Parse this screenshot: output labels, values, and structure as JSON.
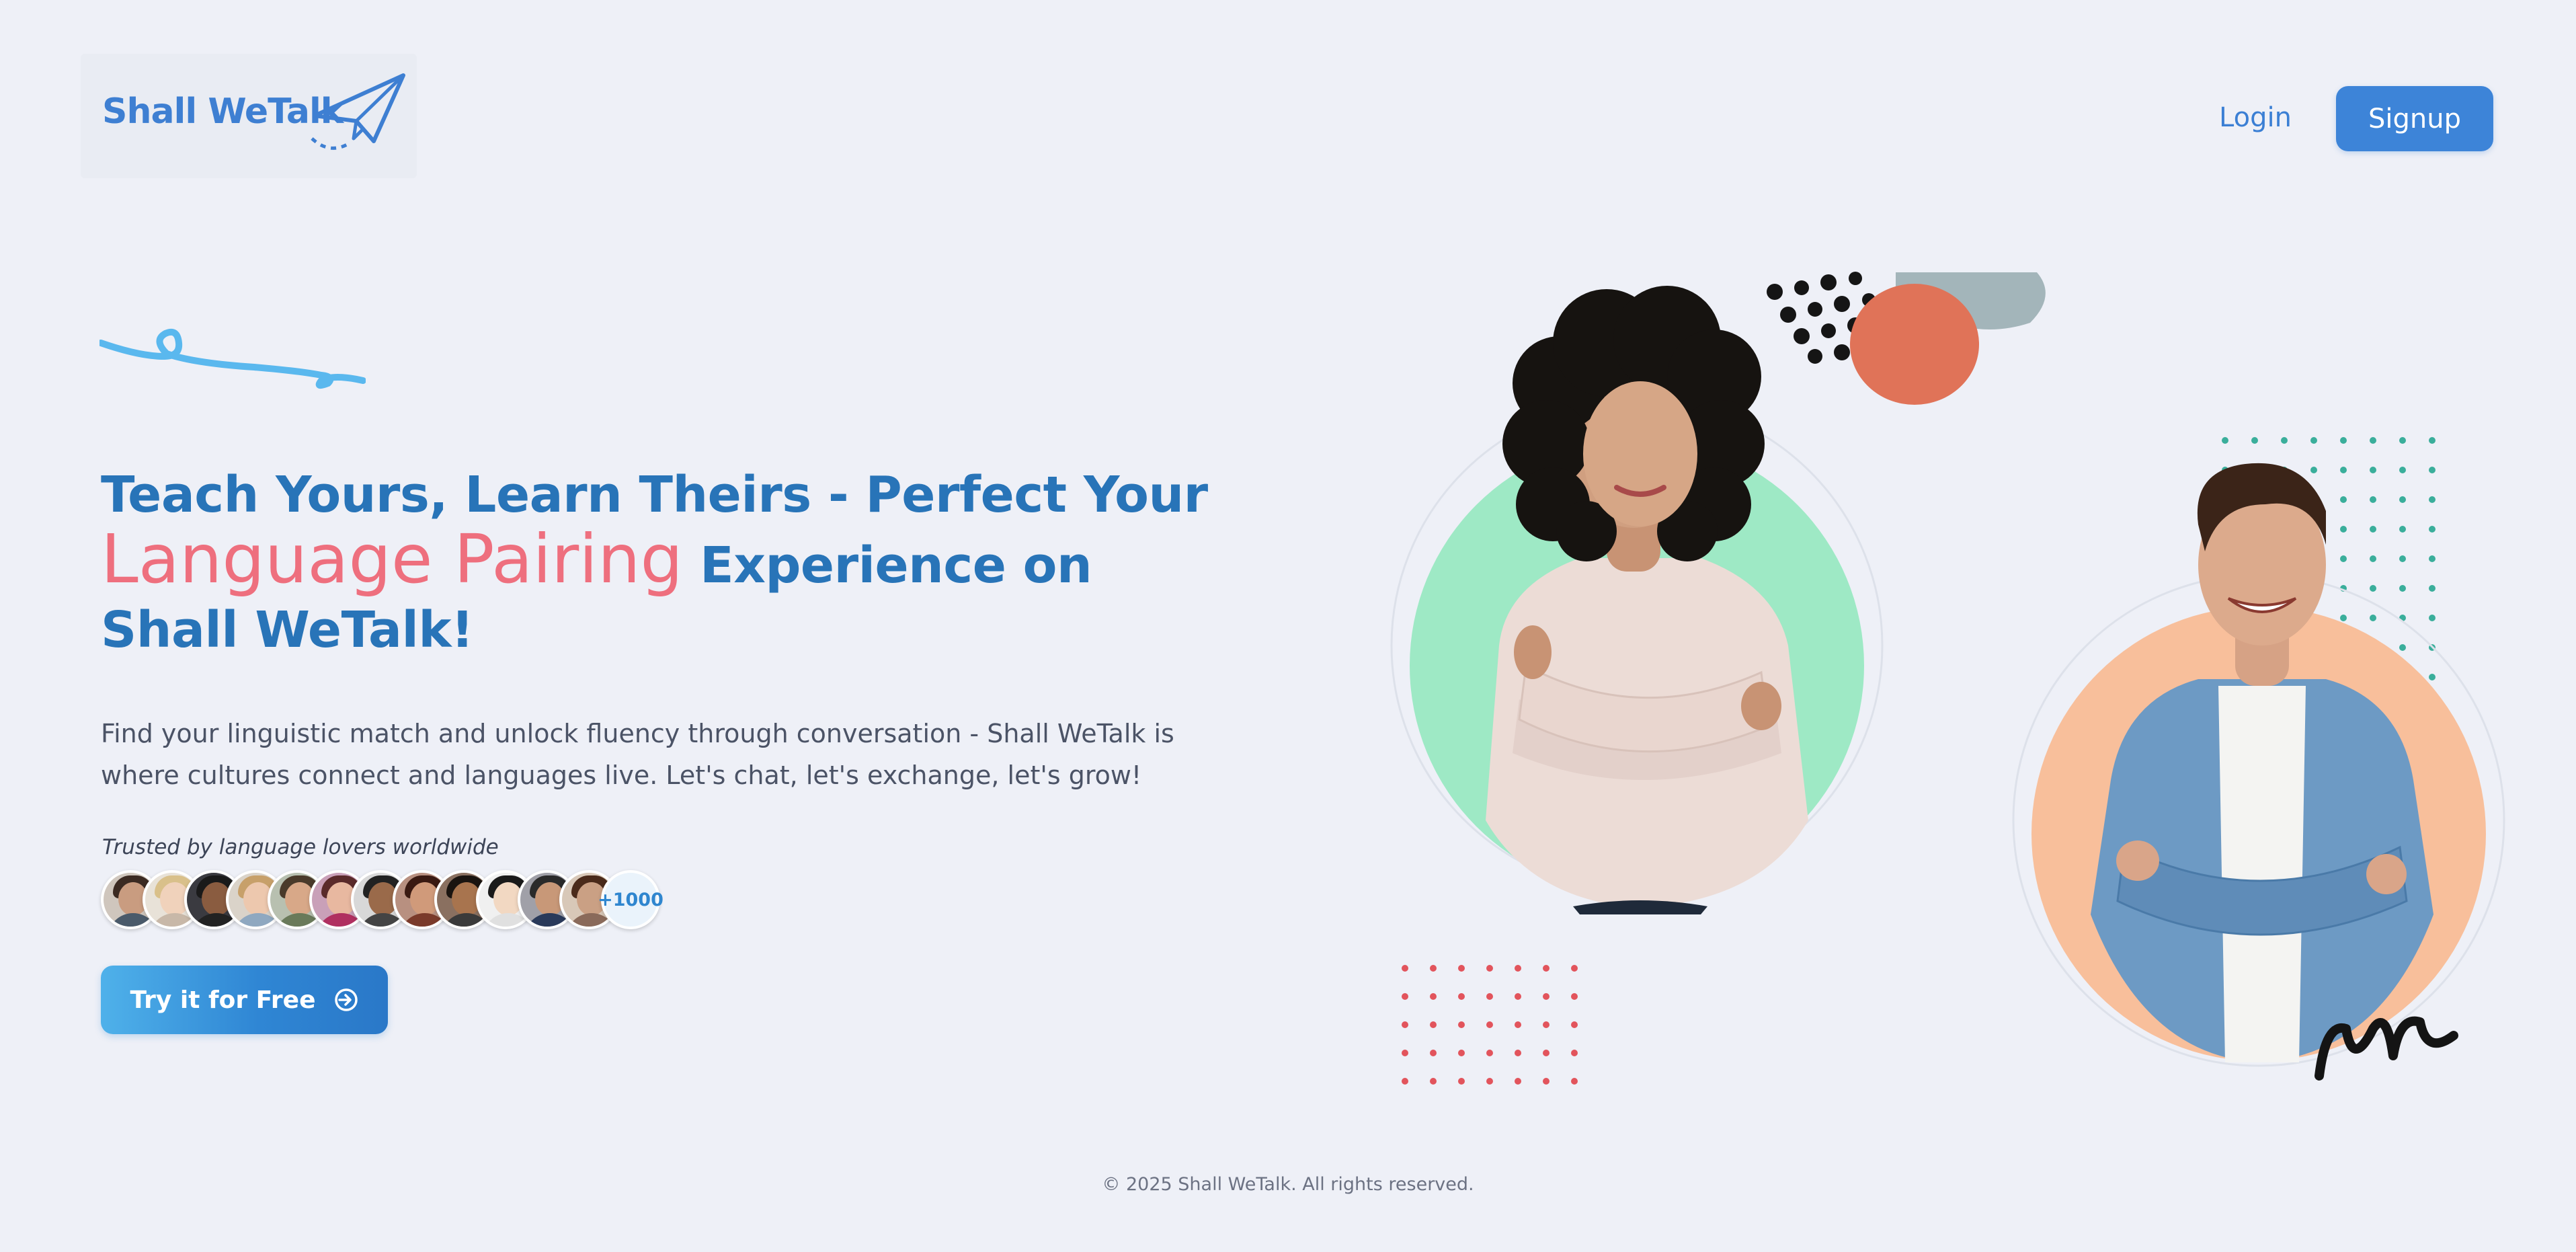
{
  "brand": {
    "name": "Shall WeTalk",
    "primary_color": "#3d84d8",
    "accent_color": "#ee6f7e"
  },
  "header": {
    "login_label": "Login",
    "signup_label": "Signup"
  },
  "hero": {
    "headline_part1": "Teach Yours, Learn Theirs - Perfect Your",
    "headline_highlight": "Language Pairing",
    "headline_part2": " Experience on Shall WeTalk!",
    "subtext": "Find your linguistic match and unlock fluency through conversation - Shall WeTalk is where cultures connect and languages live. Let's chat, let's exchange, let's grow!",
    "trusted_label": "Trusted by language lovers worldwide",
    "avatar_more": "+1000",
    "cta_label": "Try it for Free",
    "cta_icon": "login-arrow-icon"
  },
  "footer": {
    "copyright": "© 2025 Shall WeTalk. All rights reserved."
  }
}
